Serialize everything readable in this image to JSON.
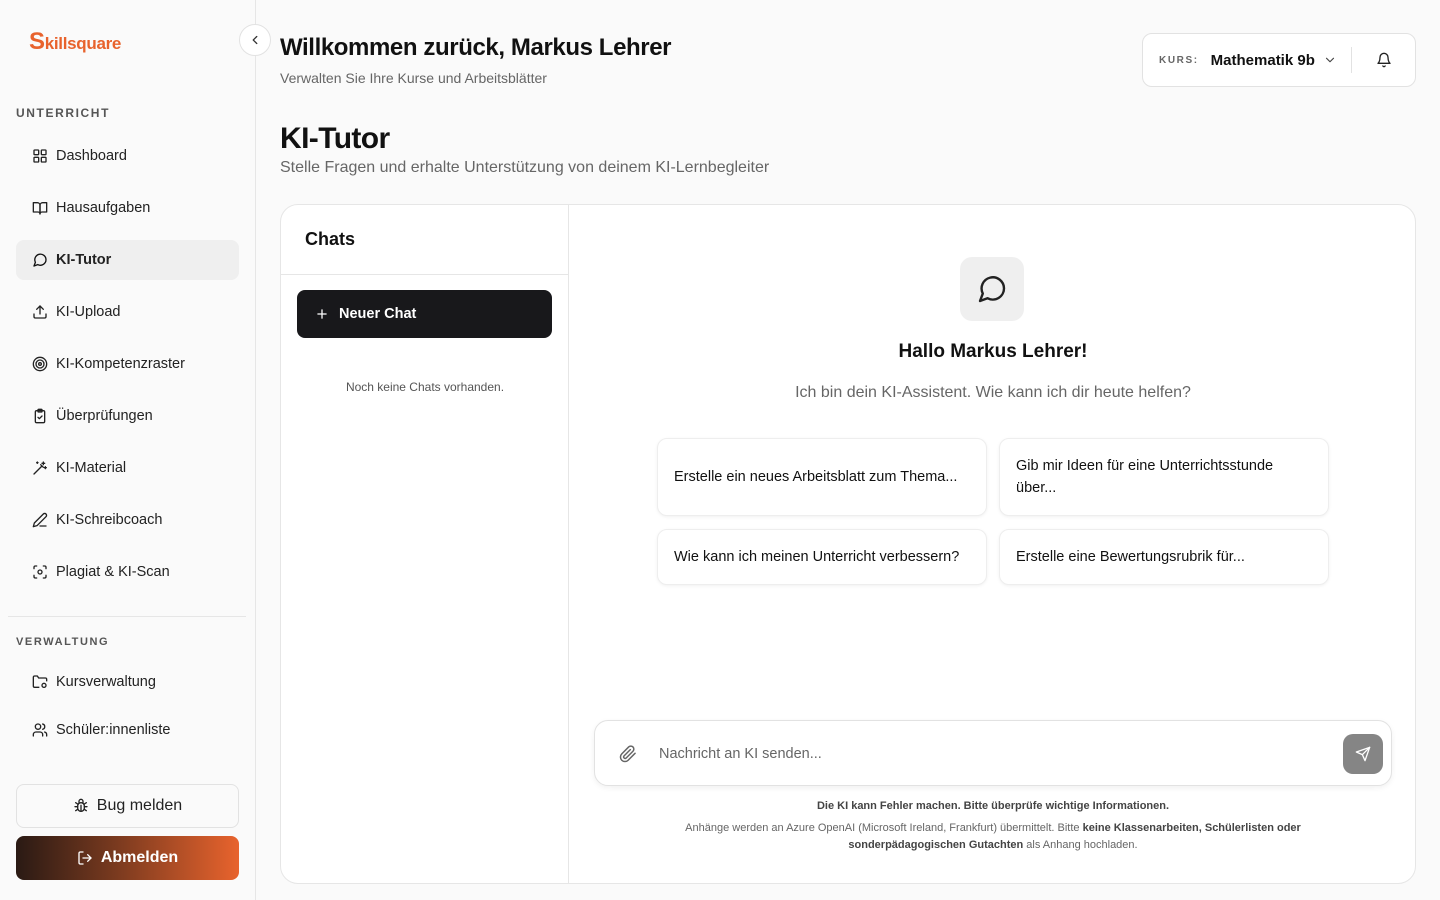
{
  "brand": {
    "logo_first": "S",
    "logo_rest": "killsquare",
    "color": "#e8632d"
  },
  "sidebar": {
    "section_teaching": "UNTERRICHT",
    "items": [
      {
        "label": "Dashboard",
        "icon": "grid-icon"
      },
      {
        "label": "Hausaufgaben",
        "icon": "book-icon"
      },
      {
        "label": "KI-Tutor",
        "icon": "message-circle-icon",
        "active": true
      },
      {
        "label": "KI-Upload",
        "icon": "upload-icon"
      },
      {
        "label": "KI-Kompetenzraster",
        "icon": "target-icon"
      },
      {
        "label": "Überprüfungen",
        "icon": "clipboard-check-icon"
      },
      {
        "label": "KI-Material",
        "icon": "magic-wand-icon"
      },
      {
        "label": "KI-Schreibcoach",
        "icon": "pen-icon"
      },
      {
        "label": "Plagiat & KI-Scan",
        "icon": "scan-face-icon"
      }
    ],
    "section_admin": "VERWALTUNG",
    "admin_items": [
      {
        "label": "Kursverwaltung",
        "icon": "folder-cog-icon"
      },
      {
        "label": "Schüler:innenliste",
        "icon": "users-icon"
      }
    ],
    "bug_label": "Bug melden",
    "logout_label": "Abmelden"
  },
  "header": {
    "title": "Willkommen zurück, Markus Lehrer",
    "subtitle": "Verwalten Sie Ihre Kurse und Arbeitsblätter",
    "course_label": "KURS:",
    "course_value": "Mathematik 9b"
  },
  "page": {
    "title": "KI-Tutor",
    "subtitle": "Stelle Fragen und erhalte Unterstützung von deinem KI-Lernbegleiter"
  },
  "chats": {
    "heading": "Chats",
    "new_chat_label": "Neuer Chat",
    "empty_text": "Noch keine Chats vorhanden."
  },
  "chat": {
    "greeting": "Hallo Markus Lehrer!",
    "greeting_sub": "Ich bin dein KI-Assistent. Wie kann ich dir heute helfen?",
    "suggestions": [
      "Erstelle ein neues Arbeitsblatt zum Thema...",
      "Gib mir Ideen für eine Unterrichtsstunde über...",
      "Wie kann ich meinen Unterricht verbessern?",
      "Erstelle eine Bewertungsrubrik für..."
    ],
    "input_placeholder": "Nachricht an KI senden...",
    "disclaimer": "Die KI kann Fehler machen. Bitte überprüfe wichtige Informationen.",
    "notice_pre": "Anhänge werden an Azure OpenAI (Microsoft Ireland, Frankfurt) übermittelt. Bitte ",
    "notice_bold": "keine Klassenarbeiten, Schülerlisten oder sonderpädagogischen Gutachten",
    "notice_post": " als Anhang hochladen."
  }
}
